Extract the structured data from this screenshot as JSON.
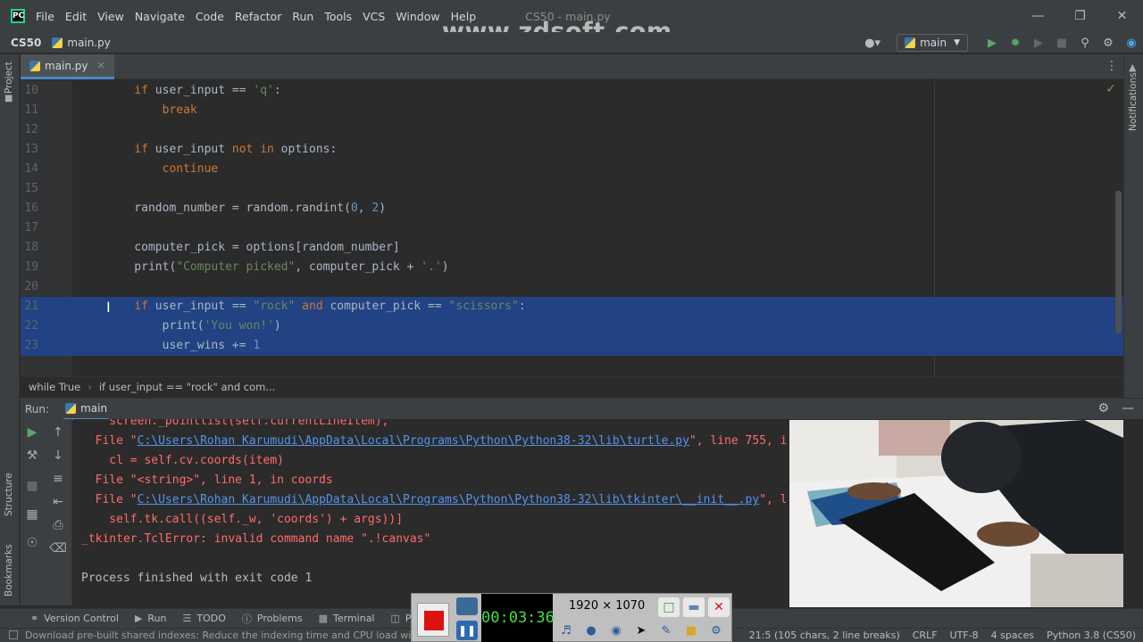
{
  "app": {
    "menu": [
      "File",
      "Edit",
      "View",
      "Navigate",
      "Code",
      "Refactor",
      "Run",
      "Tools",
      "VCS",
      "Window",
      "Help"
    ],
    "window_title": "CS50 - main.py",
    "watermark": "www.zdsoft.com"
  },
  "navbar": {
    "project": "CS50",
    "file": "main.py",
    "run_config": "main"
  },
  "tabs": [
    {
      "label": "main.py"
    }
  ],
  "left_stripe": {
    "project": "Project",
    "structure": "Structure",
    "bookmarks": "Bookmarks"
  },
  "right_stripe": {
    "notifications": "Notifications"
  },
  "editor": {
    "lines": [
      {
        "num": "10",
        "tokens": [
          [
            "",
            "    "
          ],
          [
            "kw",
            "if"
          ],
          [
            "",
            " user_input == "
          ],
          [
            "str",
            "'q'"
          ],
          [
            "",
            ":"
          ]
        ]
      },
      {
        "num": "11",
        "tokens": [
          [
            "",
            "        "
          ],
          [
            "kw",
            "break"
          ]
        ]
      },
      {
        "num": "12",
        "tokens": []
      },
      {
        "num": "13",
        "tokens": [
          [
            "",
            "    "
          ],
          [
            "kw",
            "if"
          ],
          [
            "",
            " user_input "
          ],
          [
            "kw",
            "not in"
          ],
          [
            "",
            " options:"
          ]
        ]
      },
      {
        "num": "14",
        "tokens": [
          [
            "",
            "        "
          ],
          [
            "kw",
            "continue"
          ]
        ]
      },
      {
        "num": "15",
        "tokens": []
      },
      {
        "num": "16",
        "tokens": [
          [
            "",
            "    random_number = random.randint("
          ],
          [
            "num",
            "0"
          ],
          [
            "",
            ", "
          ],
          [
            "num",
            "2"
          ],
          [
            "",
            ")"
          ]
        ]
      },
      {
        "num": "17",
        "tokens": []
      },
      {
        "num": "18",
        "tokens": [
          [
            "",
            "    computer_pick = options[random_number]"
          ]
        ]
      },
      {
        "num": "19",
        "tokens": [
          [
            "",
            "    print("
          ],
          [
            "str",
            "\"Computer picked\""
          ],
          [
            "",
            ", computer_pick + "
          ],
          [
            "str",
            "'.'"
          ],
          [
            "",
            ")"
          ]
        ]
      },
      {
        "num": "20",
        "tokens": []
      },
      {
        "num": "21",
        "selected": true,
        "tokens": [
          [
            "",
            "    "
          ],
          [
            "kw",
            "if"
          ],
          [
            "",
            " user_input == "
          ],
          [
            "str",
            "\"rock\""
          ],
          [
            "",
            " "
          ],
          [
            "kw",
            "and"
          ],
          [
            "",
            " computer_pick == "
          ],
          [
            "str",
            "\"scissors\""
          ],
          [
            "",
            ":"
          ]
        ]
      },
      {
        "num": "22",
        "selected": true,
        "tokens": [
          [
            "",
            "        print("
          ],
          [
            "str",
            "'You won!'"
          ],
          [
            "",
            ")"
          ]
        ]
      },
      {
        "num": "23",
        "selected": true,
        "tokens": [
          [
            "",
            "        user_wins += "
          ],
          [
            "num",
            "1"
          ]
        ]
      }
    ]
  },
  "breadcrumb": [
    "while True",
    "if user_input == \"rock\" and com..."
  ],
  "run_panel": {
    "label": "Run:",
    "tab": "main",
    "console": [
      [
        [
          "err",
          "    screen._pointlist(self.currentLineItem),"
        ]
      ],
      [
        [
          "err",
          "  File \""
        ],
        [
          "link",
          "C:\\Users\\Rohan Karumudi\\AppData\\Local\\Programs\\Python\\Python38-32\\lib\\turtle.py"
        ],
        [
          "err",
          "\", line 755, in _pointlist"
        ]
      ],
      [
        [
          "err",
          "    cl = self.cv.coords(item)"
        ]
      ],
      [
        [
          "err",
          "  File \"<string>\", line 1, in coords"
        ]
      ],
      [
        [
          "err",
          "  File \""
        ],
        [
          "link",
          "C:\\Users\\Rohan Karumudi\\AppData\\Local\\Programs\\Python\\Python38-32\\lib\\tkinter\\__init__.py"
        ],
        [
          "err",
          "\", line 2761, in coords"
        ]
      ],
      [
        [
          "err",
          "    self.tk.call((self._w, 'coords') + args))]"
        ]
      ],
      [
        [
          "err",
          "_tkinter.TclError: invalid command name \".!canvas\""
        ]
      ],
      [],
      [
        [
          "norm",
          "Process finished with exit code 1"
        ]
      ]
    ]
  },
  "toolwindows": [
    "Version Control",
    "Run",
    "TODO",
    "Problems",
    "Terminal",
    "Pyt"
  ],
  "status": {
    "message": "Download pre-built shared indexes: Reduce the indexing time and CPU load with pre-built Python packages shared indexes",
    "position": "21:5 (105 chars, 2 line breaks)",
    "line_sep": "CRLF",
    "encoding": "UTF-8",
    "indent": "4 spaces",
    "interpreter": "Python 3.8 (CS50)"
  },
  "recorder": {
    "timer": "00:03:36",
    "resolution": "1920 × 1070"
  }
}
